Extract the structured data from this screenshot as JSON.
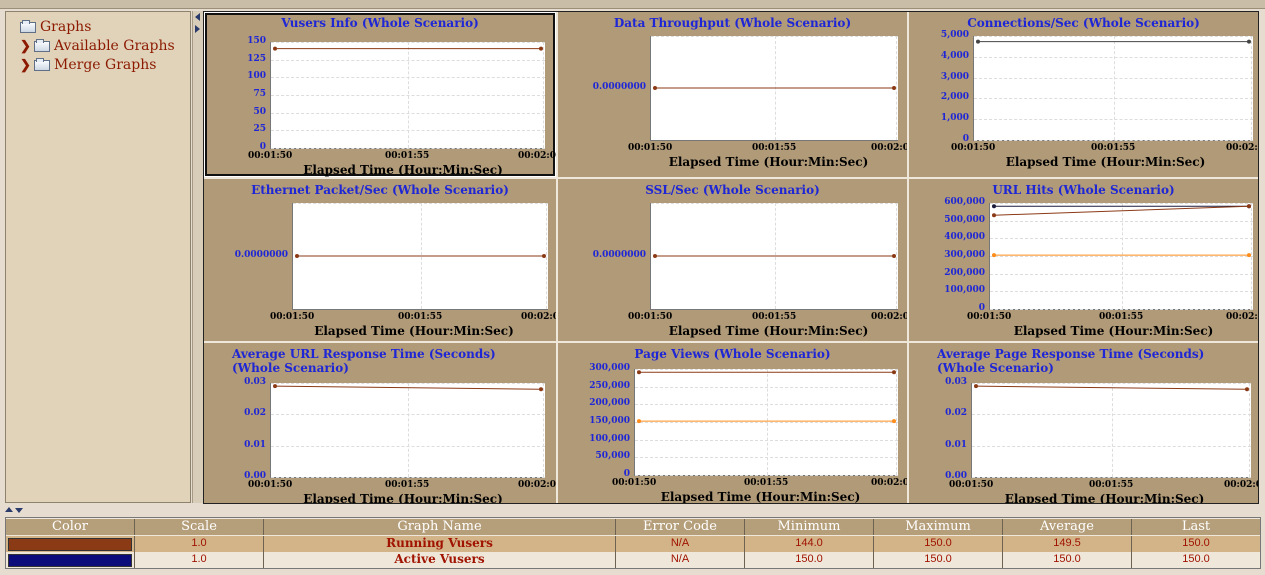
{
  "tree": {
    "root": "Graphs",
    "children": [
      "Available Graphs",
      "Merge Graphs"
    ]
  },
  "graphs": [
    {
      "title": "Vusers Info (Whole Scenario)",
      "ylabels": [
        "150",
        "125",
        "100",
        "75",
        "50",
        "25",
        "0"
      ],
      "xticks": [
        "00:01:50",
        "00:01:55",
        "00:02:0"
      ],
      "xlabel": "Elapsed Time (Hour:Min:Sec)",
      "series": [
        {
          "color": "#8b3a16",
          "from": 150,
          "to": 150
        }
      ],
      "ymax": 160
    },
    {
      "title": "Data Throughput (Whole Scenario)",
      "ylabels": [
        "0.0000000"
      ],
      "xticks": [
        "00:01:50",
        "00:01:55",
        "00:02:0"
      ],
      "xlabel": "Elapsed Time (Hour:Min:Sec)",
      "series": [
        {
          "color": "#8b3a16",
          "from": 0,
          "to": 0
        }
      ]
    },
    {
      "title": "Connections/Sec (Whole Scenario)",
      "ylabels": [
        "5,000",
        "4,000",
        "3,000",
        "2,000",
        "1,000",
        "0"
      ],
      "xticks": [
        "00:01:50",
        "00:01:55",
        "00:02:0"
      ],
      "xlabel": "Elapsed Time (Hour:Min:Sec)",
      "series": [
        {
          "color": "#444444",
          "from": 5200,
          "to": 5200
        }
      ],
      "ymax": 5500
    },
    {
      "title": "Ethernet Packet/Sec (Whole Scenario)",
      "ylabels": [
        "0.0000000"
      ],
      "xticks": [
        "00:01:50",
        "00:01:55",
        "00:02:0"
      ],
      "xlabel": "Elapsed Time (Hour:Min:Sec)",
      "series": [
        {
          "color": "#8b3a16",
          "from": 0,
          "to": 0
        }
      ]
    },
    {
      "title": "SSL/Sec (Whole Scenario)",
      "ylabels": [
        "0.0000000"
      ],
      "xticks": [
        "00:01:50",
        "00:01:55",
        "00:02:0"
      ],
      "xlabel": "Elapsed Time (Hour:Min:Sec)",
      "series": [
        {
          "color": "#8b3a16",
          "from": 0,
          "to": 0
        }
      ]
    },
    {
      "title": "URL Hits (Whole Scenario)",
      "ylabels": [
        "600,000",
        "500,000",
        "400,000",
        "300,000",
        "200,000",
        "100,000",
        "0"
      ],
      "xticks": [
        "00:01:50",
        "00:01:55",
        "00:02:0"
      ],
      "xlabel": "Elapsed Time (Hour:Min:Sec)",
      "series": [
        {
          "color": "#1a1a3a",
          "from": 630000,
          "to": 630000
        },
        {
          "color": "#8b3a16",
          "from": 575000,
          "to": 630000
        },
        {
          "color": "#ff8c1a",
          "from": 330000,
          "to": 330000
        }
      ],
      "ymax": 650000
    },
    {
      "title": "Average URL Response Time (Seconds) (Whole Scenario)",
      "ylabels": [
        "0.03",
        "0.02",
        "0.01",
        "0.00"
      ],
      "xticks": [
        "00:01:50",
        "00:01:55",
        "00:02:0"
      ],
      "xlabel": "Elapsed Time (Hour:Min:Sec)",
      "series": [
        {
          "color": "#8b3a16",
          "from": 0.029,
          "to": 0.028
        }
      ],
      "ymax": 0.03
    },
    {
      "title": "Page Views (Whole Scenario)",
      "ylabels": [
        "300,000",
        "250,000",
        "200,000",
        "150,000",
        "100,000",
        "50,000",
        "0"
      ],
      "xticks": [
        "00:01:50",
        "00:01:55",
        "00:02:0"
      ],
      "xlabel": "Elapsed Time (Hour:Min:Sec)",
      "series": [
        {
          "color": "#8b3a16",
          "from": 315000,
          "to": 315000
        },
        {
          "color": "#ff8c1a",
          "from": 165000,
          "to": 165000
        }
      ],
      "ymax": 325000
    },
    {
      "title": "Average Page Response Time (Seconds) (Whole Scenario)",
      "ylabels": [
        "0.03",
        "0.02",
        "0.01",
        "0.00"
      ],
      "xticks": [
        "00:01:50",
        "00:01:55",
        "00:02:0"
      ],
      "xlabel": "Elapsed Time (Hour:Min:Sec)",
      "series": [
        {
          "color": "#8b3a16",
          "from": 0.029,
          "to": 0.028
        }
      ],
      "ymax": 0.03
    }
  ],
  "legend": {
    "headers": [
      "Color",
      "Scale",
      "Graph Name",
      "Error Code",
      "Minimum",
      "Maximum",
      "Average",
      "Last"
    ],
    "rows": [
      {
        "color": "#8b3a16",
        "scale": "1.0",
        "name": "Running Vusers",
        "error": "N/A",
        "min": "144.0",
        "max": "150.0",
        "avg": "149.5",
        "last": "150.0"
      },
      {
        "color": "#0c0c7a",
        "scale": "1.0",
        "name": "Active Vusers",
        "error": "N/A",
        "min": "150.0",
        "max": "150.0",
        "avg": "150.0",
        "last": "150.0"
      }
    ]
  }
}
